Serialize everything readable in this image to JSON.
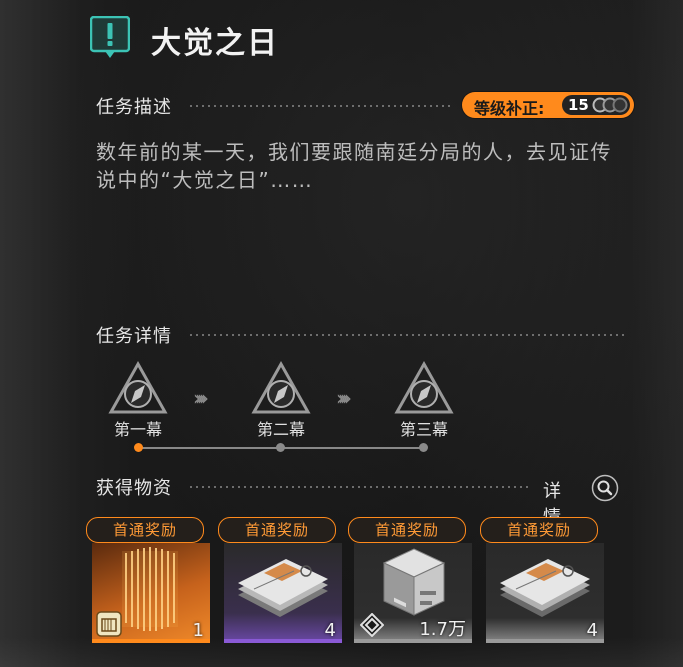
{
  "header": {
    "title": "大觉之日",
    "icon": "exclamation-alert-icon"
  },
  "description_section": {
    "heading": "任务描述",
    "level_correction": {
      "label": "等级补正:",
      "value": "15"
    },
    "text_line1": "数年前的某一天，我们要跟随南廷分局的人，去见证传",
    "text_line2": "说中的“大觉之日”……"
  },
  "details_section": {
    "heading": "任务详情",
    "acts": [
      {
        "label": "第一幕",
        "active": true
      },
      {
        "label": "第二幕",
        "active": false
      },
      {
        "label": "第三幕",
        "active": false
      }
    ]
  },
  "rewards_section": {
    "heading": "获得物资",
    "details_label": "详情",
    "items": [
      {
        "tag": "首通奖励",
        "count": "1",
        "rarity": "gold"
      },
      {
        "tag": "首通奖励",
        "count": "4",
        "rarity": "purple"
      },
      {
        "tag": "首通奖励",
        "count": "1.7万",
        "rarity": "gray"
      },
      {
        "tag": "首通奖励",
        "count": "4",
        "rarity": "gray"
      }
    ]
  },
  "colors": {
    "accent": "#ff8a1c",
    "teal": "#3cc3b5",
    "purple": "#6b49a8"
  }
}
